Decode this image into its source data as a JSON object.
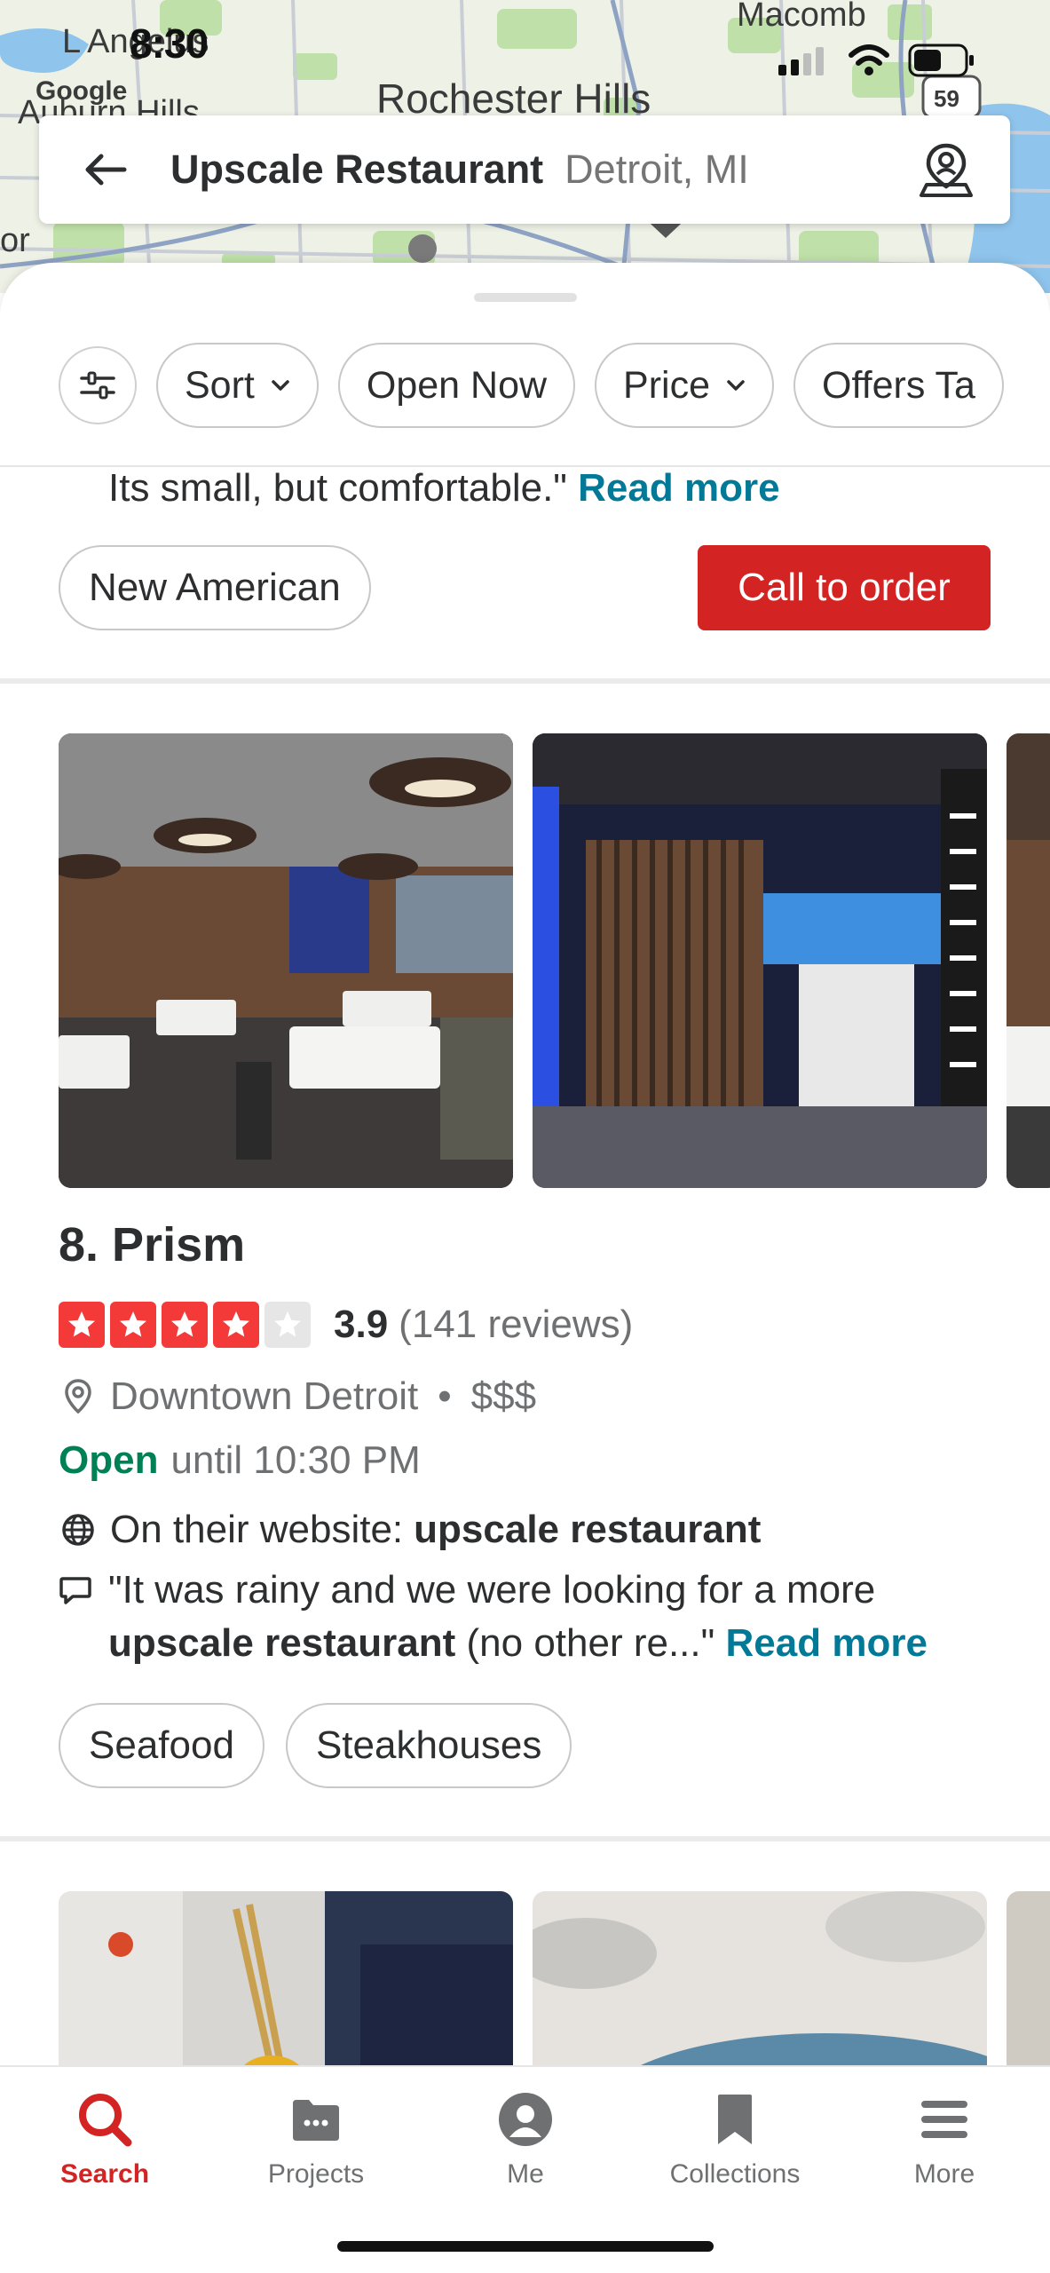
{
  "status_bar": {
    "time": "8:30"
  },
  "map": {
    "labels": {
      "l_angelus": "L Angelus",
      "macomb": "Macomb",
      "google": "Google",
      "auburn_hills": "Auburn Hills",
      "rochester_hills": "Rochester Hills",
      "highway": "59",
      "edge": "or"
    }
  },
  "search": {
    "query": "Upscale Restaurant",
    "location": "Detroit, MI"
  },
  "filters": {
    "sort": "Sort",
    "open_now": "Open Now",
    "price": "Price",
    "offers": "Offers Ta"
  },
  "previous_result": {
    "snippet_tail": "Its small, but comfortable.\"",
    "read_more": "Read more",
    "category": "New American",
    "call_to_order": "Call to order"
  },
  "result": {
    "name": "8. Prism",
    "rating": "3.9",
    "rating_stars": 3.9,
    "review_count": "(141 reviews)",
    "neighborhood": "Downtown Detroit",
    "separator": "•",
    "price": "$$$",
    "open_status": "Open",
    "hours": "until 10:30 PM",
    "website_label": "On their website:",
    "website_match": "upscale restaurant",
    "snippet_open": "\"It was rainy and we were looking for a more",
    "snippet_match": "upscale restaurant",
    "snippet_close": " (no other re...\"",
    "read_more": "Read more",
    "categories": [
      "Seafood",
      "Steakhouses"
    ]
  },
  "nav": {
    "search": "Search",
    "projects": "Projects",
    "me": "Me",
    "collections": "Collections",
    "more": "More"
  },
  "colors": {
    "brand_red": "#d32323",
    "link_teal": "#027a97",
    "open_green": "#008055",
    "star_red": "#f43939"
  },
  "icons": [
    "back-arrow-icon",
    "map-pin-person-icon",
    "filter-sliders-icon",
    "chevron-down-icon",
    "star-icon",
    "location-pin-icon",
    "globe-icon",
    "speech-bubble-icon",
    "search-icon",
    "projects-folder-icon",
    "me-avatar-icon",
    "collections-bookmark-icon",
    "more-menu-icon"
  ]
}
